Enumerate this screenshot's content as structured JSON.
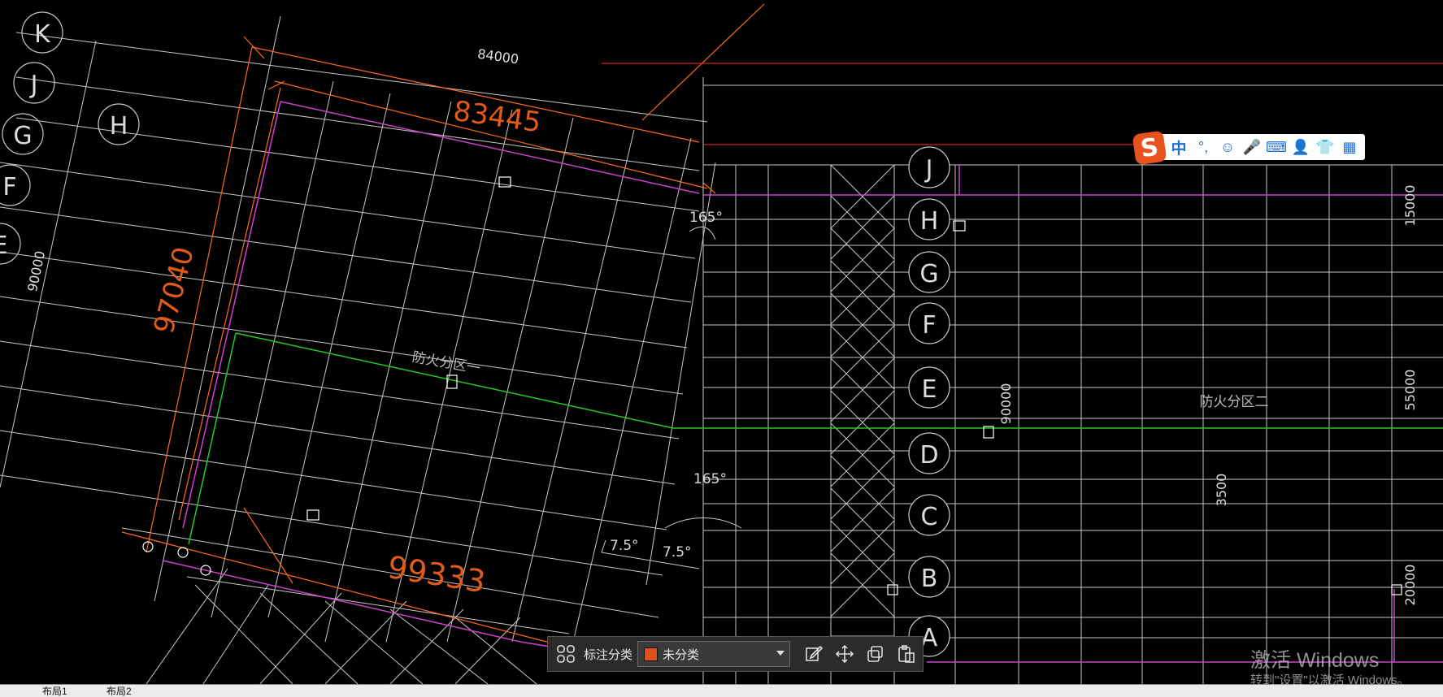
{
  "drawing": {
    "left_grid_labels": [
      "K",
      "J",
      "G",
      "H",
      "F",
      "E"
    ],
    "right_grid_labels": [
      "J",
      "H",
      "G",
      "F",
      "E",
      "D",
      "C",
      "B",
      "A"
    ],
    "dimensions": {
      "top": "84000",
      "top_inner": "83445",
      "left_long": "97040",
      "left_side": "90000",
      "bottom": "99333",
      "right_mid": "90000",
      "right_edge_top": "15000",
      "right_edge_mid": "55000",
      "right_edge_bottom": "20000",
      "small": "3500"
    },
    "angles": {
      "top": "165°",
      "middle": "165°",
      "left_small": "7.5°",
      "right_small": "7.5°"
    },
    "zones": {
      "zone_one": "防火分区一",
      "zone_two": "防火分区二"
    }
  },
  "tabs": [
    "布局1",
    "布局2"
  ],
  "ime": {
    "lang": "中",
    "punct": "°,"
  },
  "annotation_bar": {
    "label": "标注分类",
    "selected": "未分类",
    "swatch_color": "#e0501b"
  },
  "watermark": {
    "title": "激活 Windows",
    "subtitle": "转到\"设置\"以激活 Windows。"
  },
  "colors": {
    "grid": "#c8c8c8",
    "dimension": "#ff6a1a",
    "magenta": "#d040d0",
    "green": "#22cc22",
    "red": "#ff2a2a",
    "ime_brand": "#e8521f",
    "ime_icon": "#1f6fd9"
  }
}
